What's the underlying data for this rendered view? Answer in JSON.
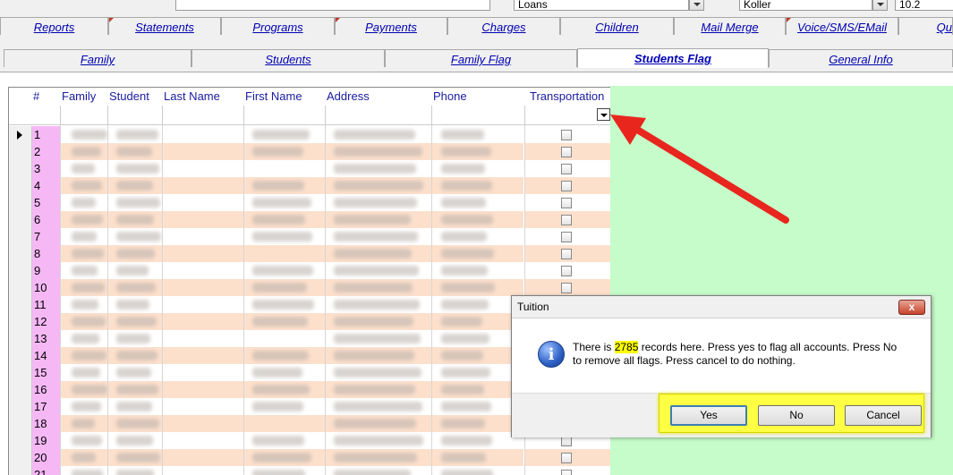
{
  "top_fields": {
    "field1": "",
    "field2": "Loans",
    "field3": "Koller",
    "field4": "10.2"
  },
  "tabs_row1": [
    "Reports",
    "Statements",
    "Programs",
    "Payments",
    "Charges",
    "Children",
    "Mail Merge",
    "Voice/SMS/EMail",
    "Qu"
  ],
  "tabs_row2": [
    "Family",
    "Students",
    "Family Flag",
    "Students Flag",
    "General Info"
  ],
  "active_tab": "Students Flag",
  "grid": {
    "columns": [
      "#",
      "Family",
      "Student",
      "Last Name",
      "First Name",
      "Address",
      "Phone",
      "Transportation"
    ],
    "row_numbers": [
      "1",
      "2",
      "3",
      "4",
      "5",
      "6",
      "7",
      "8",
      "9",
      "10",
      "11",
      "12",
      "13",
      "14",
      "15",
      "16",
      "17",
      "18",
      "19",
      "20",
      "21"
    ],
    "transportation_checked": false
  },
  "dialog": {
    "title": "Tuition",
    "close_glyph": "x",
    "icon_glyph": "i",
    "message_before": "There is ",
    "message_count": "2785",
    "message_after": " records here. Press yes to flag all accounts. Press No to remove all flags. Press cancel to do nothing.",
    "buttons": {
      "yes": "Yes",
      "no": "No",
      "cancel": "Cancel"
    }
  },
  "colors": {
    "stripe": "#fde0cc",
    "row_number_bg": "#f5b8f5",
    "green_panel": "#c6fcc9",
    "highlight": "#ffff00",
    "annotation_arrow": "#e8261e"
  }
}
